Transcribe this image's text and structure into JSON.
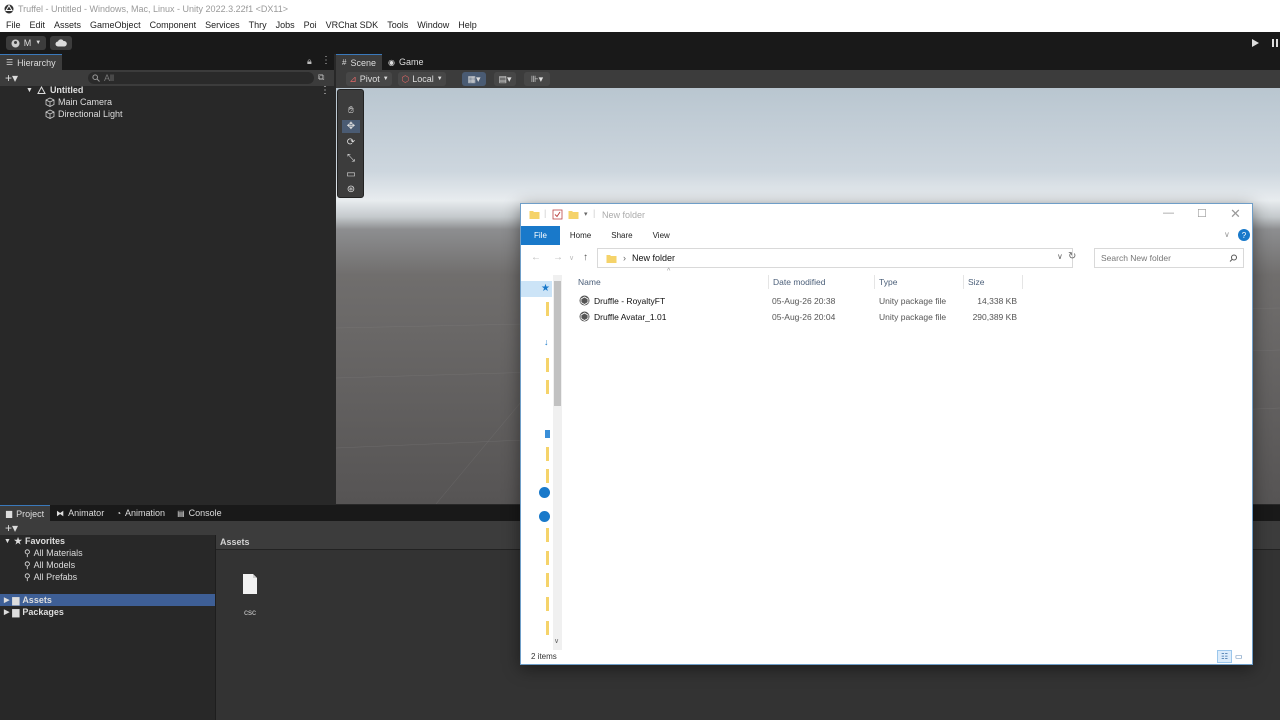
{
  "window_title": "Truffel - Untitled - Windows, Mac, Linux - Unity 2022.3.22f1 <DX11>",
  "menu": [
    "File",
    "Edit",
    "Assets",
    "GameObject",
    "Component",
    "Services",
    "Thry",
    "Jobs",
    "Poi",
    "VRChat SDK",
    "Tools",
    "Window",
    "Help"
  ],
  "toolbar": {
    "account_label": "M"
  },
  "hierarchy": {
    "tab_label": "Hierarchy",
    "search_placeholder": "All",
    "scene_name": "Untitled",
    "items": [
      "Main Camera",
      "Directional Light"
    ]
  },
  "scene": {
    "tabs": [
      "Scene",
      "Game"
    ],
    "pivot_label": "Pivot",
    "local_label": "Local"
  },
  "project": {
    "tabs": [
      "Project",
      "Animator",
      "Animation",
      "Console"
    ],
    "favorites_label": "Favorites",
    "favorites": [
      "All Materials",
      "All Models",
      "All Prefabs"
    ],
    "roots": [
      "Assets",
      "Packages"
    ],
    "assets_header": "Assets",
    "asset_files": [
      "csc"
    ]
  },
  "explorer": {
    "title": "New folder",
    "ribbon_tabs": [
      "File",
      "Home",
      "Share",
      "View"
    ],
    "address": "New folder",
    "search_placeholder": "Search New folder",
    "columns": [
      "Name",
      "Date modified",
      "Type",
      "Size"
    ],
    "files": [
      {
        "name": "Druffle - RoyaltyFT",
        "date": "05-Aug-26 20:38",
        "type": "Unity package file",
        "size": "14,338 KB"
      },
      {
        "name": "Druffle Avatar_1.01",
        "date": "05-Aug-26 20:04",
        "type": "Unity package file",
        "size": "290,389 KB"
      }
    ],
    "status": "2 items"
  },
  "colors": {
    "unity_dark": "#191919",
    "unity_panel": "#282828",
    "unity_tab": "#3c3c3c",
    "win_accent": "#1979ca",
    "selection": "#3e5f96"
  }
}
